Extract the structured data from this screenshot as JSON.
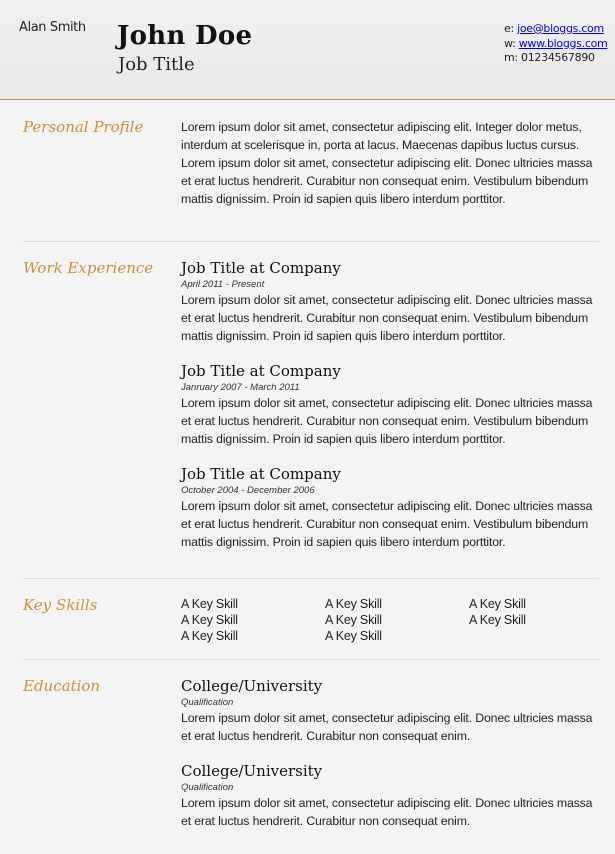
{
  "header": {
    "alt_name": "Alan Smith",
    "name": "John Doe",
    "job_title": "Job Title",
    "contact": {
      "email_label": "e: ",
      "email": "joe@bloggs.com",
      "web_label": "w: ",
      "web": "www.bloggs.com",
      "phone_label": "m: ",
      "phone": "01234567890"
    }
  },
  "profile": {
    "title": "Personal Profile",
    "text": "Lorem ipsum dolor sit amet, consectetur adipiscing elit. Integer dolor metus, interdum at scelerisque in, porta at lacus. Maecenas dapibus luctus cursus. Lorem ipsum dolor sit amet, consectetur adipiscing elit. Donec ultricies massa et erat luctus hendrerit. Curabitur non consequat enim. Vestibulum bibendum mattis dignissim. Proin id sapien quis libero interdum porttitor."
  },
  "work": {
    "title": "Work Experience",
    "jobs": [
      {
        "title": "Job Title at Company",
        "date": "April 2011 - Present",
        "text": "Lorem ipsum dolor sit amet, consectetur adipiscing elit. Donec ultricies massa et erat luctus hendrerit. Curabitur non consequat enim. Vestibulum bibendum mattis dignissim. Proin id sapien quis libero interdum porttitor."
      },
      {
        "title": "Job Title at Company",
        "date": "Janruary 2007 - March 2011",
        "text": "Lorem ipsum dolor sit amet, consectetur adipiscing elit. Donec ultricies massa et erat luctus hendrerit. Curabitur non consequat enim. Vestibulum bibendum mattis dignissim. Proin id sapien quis libero interdum porttitor."
      },
      {
        "title": "Job Title at Company",
        "date": "October 2004 - December 2006",
        "text": "Lorem ipsum dolor sit amet, consectetur adipiscing elit. Donec ultricies massa et erat luctus hendrerit. Curabitur non consequat enim. Vestibulum bibendum mattis dignissim. Proin id sapien quis libero interdum porttitor."
      }
    ]
  },
  "skills": {
    "title": "Key Skills",
    "columns": [
      [
        "A Key Skill",
        "A Key Skill",
        "A Key Skill"
      ],
      [
        "A Key Skill",
        "A Key Skill",
        "A Key Skill"
      ],
      [
        "A Key Skill",
        "A Key Skill"
      ]
    ]
  },
  "education": {
    "title": "Education",
    "items": [
      {
        "title": "College/University",
        "qualification": "Qualification",
        "text": "Lorem ipsum dolor sit amet, consectetur adipiscing elit. Donec ultricies massa et erat luctus hendrerit. Curabitur non consequat enim."
      },
      {
        "title": "College/University",
        "qualification": "Qualification",
        "text": "Lorem ipsum dolor sit amet, consectetur adipiscing elit. Donec ultricies massa et erat luctus hendrerit. Curabitur non consequat enim."
      }
    ]
  },
  "colors": {
    "accent": "#c8923a",
    "background": "#f3f3f3",
    "link": "#0000ee"
  }
}
